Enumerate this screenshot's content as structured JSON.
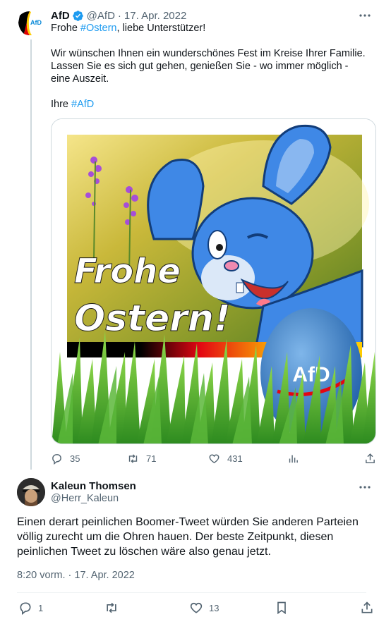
{
  "tweet": {
    "display_name": "AfD",
    "handle": "@AfD",
    "date": "17. Apr. 2022",
    "avatar_label": "AfD",
    "text": {
      "line1_pre": "Frohe ",
      "line1_hashtag": "#Ostern",
      "line1_post": ", liebe Unterstützer!",
      "paragraph2": "Wir wünschen Ihnen ein wunderschönes Fest im Kreise Ihrer Familie. Lassen Sie es sich gut gehen, genießen Sie - wo immer möglich - eine Auszeit.",
      "sign_pre": "Ihre ",
      "sign_hashtag": "#AfD"
    },
    "image": {
      "headline_1": "Frohe",
      "headline_2": "Ostern!",
      "egg_logo": "AfD"
    },
    "stats": {
      "replies": "35",
      "retweets": "71",
      "likes": "431"
    }
  },
  "reply": {
    "display_name": "Kaleun Thomsen",
    "handle": "@Herr_Kaleun",
    "text": "Einen derart peinlichen Boomer-Tweet würden Sie anderen Parteien völlig zurecht um die Ohren hauen. Der beste Zeitpunkt, diesen peinlichen Tweet zu löschen wäre also genau jetzt.",
    "timestamp": "8:20 vorm. · 17. Apr. 2022",
    "stats": {
      "replies": "1",
      "likes": "13"
    }
  },
  "icons": [
    "verified-badge-icon",
    "more-icon",
    "reply-icon",
    "retweet-icon",
    "like-icon",
    "views-icon",
    "share-icon",
    "bookmark-icon"
  ],
  "colors": {
    "accent": "#1d9bf0",
    "text": "#0f1419",
    "secondary": "#536471",
    "border": "#cfd9de"
  }
}
